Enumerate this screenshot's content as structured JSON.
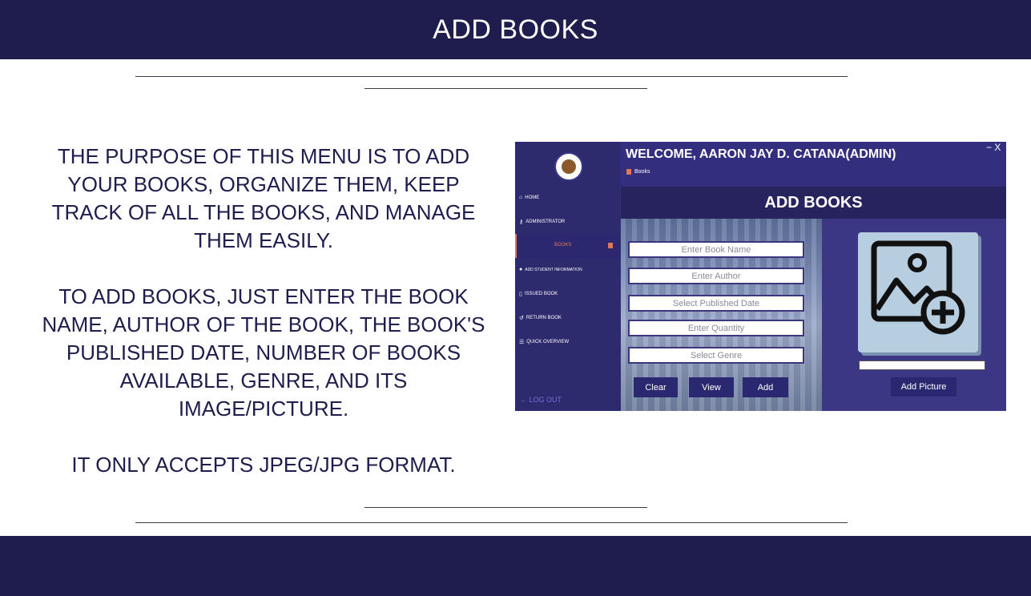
{
  "slide": {
    "title": "ADD BOOKS",
    "paragraphs": [
      "THE PURPOSE OF THIS MENU IS TO ADD YOUR BOOKS, ORGANIZE THEM, KEEP TRACK OF ALL THE BOOKS, AND MANAGE THEM EASILY.",
      "TO ADD BOOKS, JUST ENTER THE BOOK NAME, AUTHOR OF THE BOOK, THE BOOK'S PUBLISHED DATE, NUMBER OF BOOKS AVAILABLE, GENRE, AND ITS IMAGE/PICTURE.",
      "IT ONLY ACCEPTS JPEG/JPG FORMAT."
    ]
  },
  "app": {
    "welcome": "WELCOME, AARON JAY D. CATANA(ADMIN)",
    "breadcrumb": "Books",
    "window_controls": "− X",
    "header_title": "ADD BOOKS",
    "sidebar": {
      "items": [
        {
          "label": "HOME",
          "icon": "home-icon",
          "glyph": "⌂"
        },
        {
          "label": "ADMINISTRATOR",
          "icon": "key-icon",
          "glyph": "⚷"
        },
        {
          "label": "BOOKS",
          "icon": "book-icon",
          "glyph": ""
        },
        {
          "label": "ADD STUDENT INFORMATION",
          "icon": "info-icon",
          "glyph": "●"
        },
        {
          "label": "ISSUED BOOK",
          "icon": "bookmark-icon",
          "glyph": "▯"
        },
        {
          "label": "RETURN BOOK",
          "icon": "undo-icon",
          "glyph": "↺"
        },
        {
          "label": "QUICK OVERVIEW",
          "icon": "list-icon",
          "glyph": "☰"
        }
      ],
      "logout": "← LOG OUT"
    },
    "form": {
      "book_name_placeholder": "Enter Book Name",
      "author_placeholder": "Enter Author",
      "published_date_placeholder": "Select Published Date",
      "quantity_placeholder": "Enter Quantity",
      "genre_placeholder": "Select Genre"
    },
    "buttons": {
      "clear": "Clear",
      "view": "View",
      "add": "Add",
      "add_picture": "Add Picture"
    }
  },
  "colors": {
    "bar": "#1e1d4d",
    "sidebar": "#2e2a6e",
    "accent": "#e2765a"
  }
}
